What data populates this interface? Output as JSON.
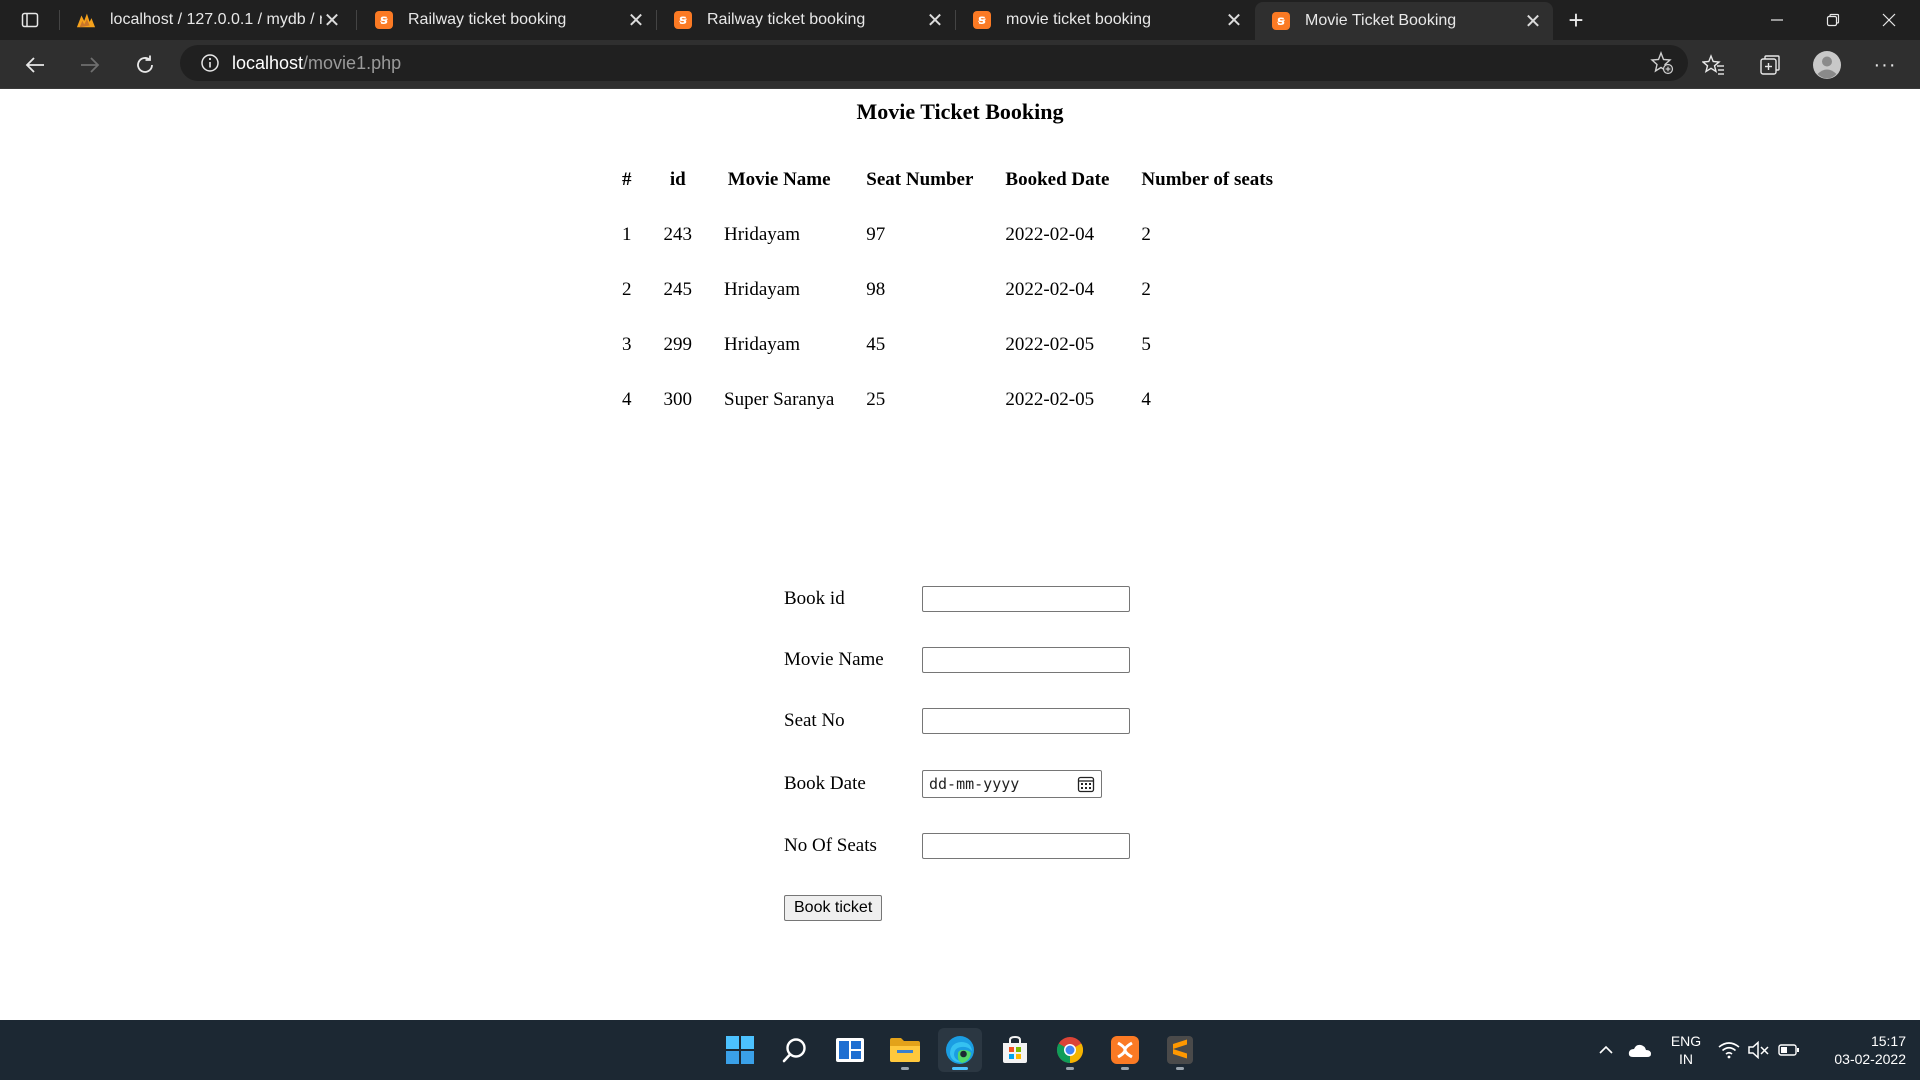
{
  "browser": {
    "tabs": [
      {
        "title": "localhost / 127.0.0.1 / mydb / mo",
        "icon": "phpmyadmin-icon"
      },
      {
        "title": "Railway ticket booking",
        "icon": "xampp-icon"
      },
      {
        "title": "Railway ticket booking",
        "icon": "xampp-icon"
      },
      {
        "title": "movie ticket booking",
        "icon": "xampp-icon"
      },
      {
        "title": "Movie Ticket Booking",
        "icon": "xampp-icon",
        "active": true
      }
    ],
    "url_host": "localhost",
    "url_path": "/movie1.php"
  },
  "page": {
    "title": "Movie Ticket Booking",
    "table": {
      "headers": [
        "#",
        "id",
        "Movie Name",
        "Seat Number",
        "Booked Date",
        "Number of seats"
      ],
      "rows": [
        [
          "1",
          "243",
          "Hridayam",
          "97",
          "2022-02-04",
          "2"
        ],
        [
          "2",
          "245",
          "Hridayam",
          "98",
          "2022-02-04",
          "2"
        ],
        [
          "3",
          "299",
          "Hridayam",
          "45",
          "2022-02-05",
          "5"
        ],
        [
          "4",
          "300",
          "Super Saranya",
          "25",
          "2022-02-05",
          "4"
        ]
      ]
    },
    "form": {
      "book_id_label": "Book id",
      "movie_name_label": "Movie Name",
      "seat_no_label": "Seat No",
      "book_date_label": "Book Date",
      "book_date_placeholder": "dd-mm-yyyy",
      "no_of_seats_label": "No Of Seats",
      "submit_label": "Book ticket"
    }
  },
  "taskbar": {
    "lang_top": "ENG",
    "lang_bottom": "IN",
    "time": "15:17",
    "date": "03-02-2022"
  },
  "colors": {
    "tabstrip_bg": "#202020",
    "toolbar_bg": "#2f2f2f",
    "taskbar_bg": "#1c2833",
    "xampp_orange": "#fb7a24",
    "edge_blue": "#4cc2ff"
  }
}
